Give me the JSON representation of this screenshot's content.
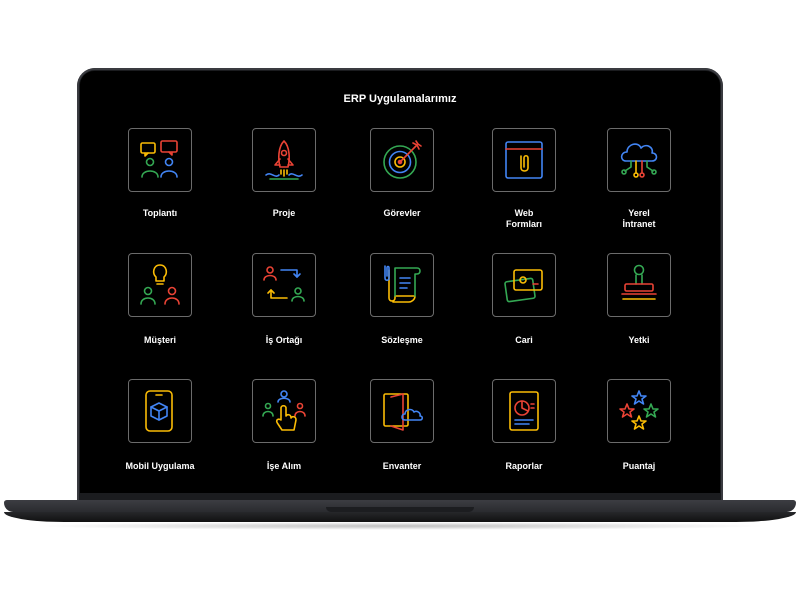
{
  "screen": {
    "title": "ERP Uygulamalarımız"
  },
  "apps": [
    {
      "label": "Toplantı",
      "icon": "meeting-icon"
    },
    {
      "label": "Proje",
      "icon": "rocket-icon"
    },
    {
      "label": "Görevler",
      "icon": "target-icon"
    },
    {
      "label": "Web Formları",
      "icon": "web-form-icon"
    },
    {
      "label": "Yerel İntranet",
      "icon": "cloud-network-icon"
    },
    {
      "label": "Müşteri",
      "icon": "customer-idea-icon"
    },
    {
      "label": "İş Ortağı",
      "icon": "partner-exchange-icon"
    },
    {
      "label": "Sözleşme",
      "icon": "contract-scroll-icon"
    },
    {
      "label": "Cari",
      "icon": "cards-icon"
    },
    {
      "label": "Yetki",
      "icon": "stamp-icon"
    },
    {
      "label": "Mobil Uygulama",
      "icon": "mobile-cube-icon"
    },
    {
      "label": "İşe Alım",
      "icon": "hiring-touch-icon"
    },
    {
      "label": "Envanter",
      "icon": "inventory-cloud-icon"
    },
    {
      "label": "Raporlar",
      "icon": "report-chart-icon"
    },
    {
      "label": "Puantaj",
      "icon": "stars-icon"
    }
  ]
}
